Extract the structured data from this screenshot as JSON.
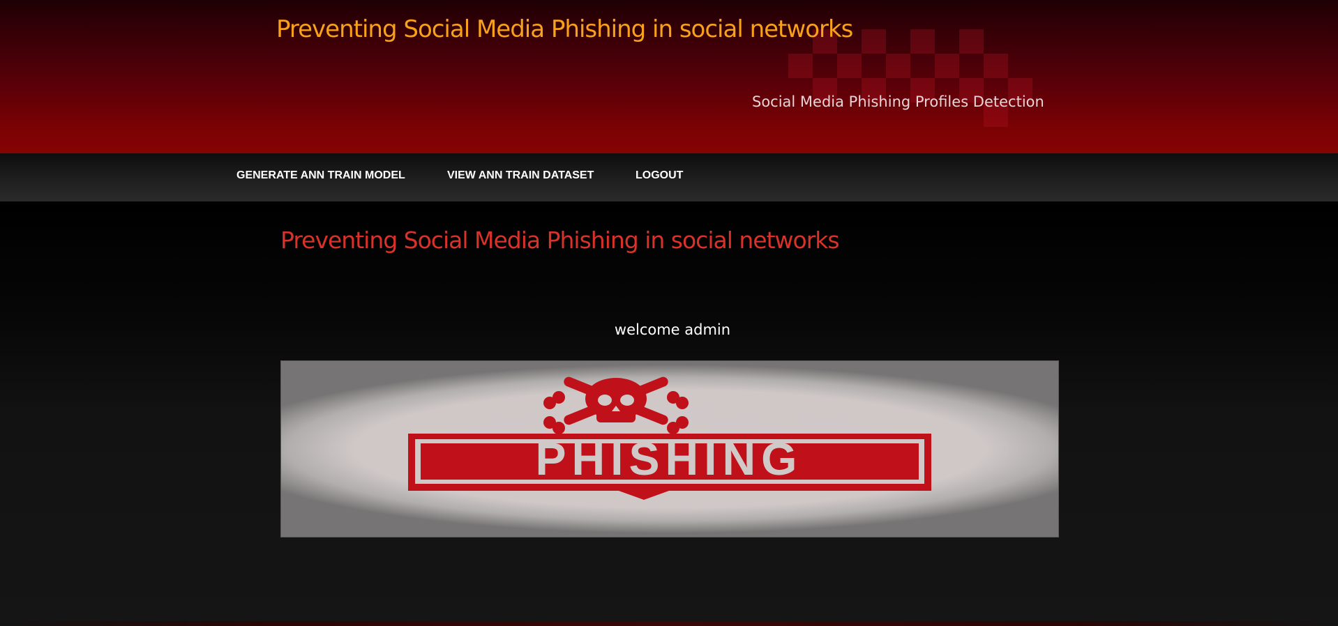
{
  "header": {
    "title": "Preventing Social Media Phishing in social networks",
    "subtitle": "Social Media Phishing Profiles Detection"
  },
  "nav": {
    "items": [
      {
        "label": "GENERATE ANN TRAIN MODEL"
      },
      {
        "label": "VIEW ANN TRAIN DATASET"
      },
      {
        "label": "LOGOUT"
      }
    ]
  },
  "main": {
    "heading": "Preventing Social Media Phishing in social networks",
    "welcome": "welcome admin",
    "banner": {
      "text": "PHISHING",
      "icon": "skull-crossbones-icon"
    }
  },
  "colors": {
    "title": "#f7a21a",
    "heading": "#d9322a",
    "header_red": "#860303",
    "banner_red": "#c0101a"
  }
}
